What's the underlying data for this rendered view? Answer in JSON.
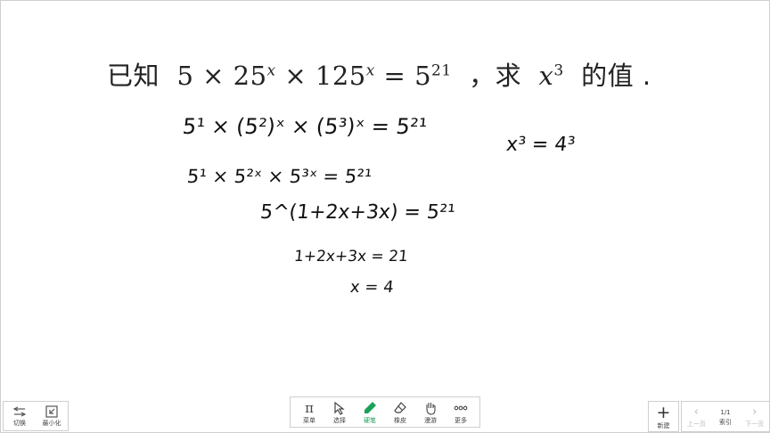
{
  "problem": {
    "prefix": "已知",
    "expr_a": "5 × 25",
    "exp_x1": "x",
    "expr_b": " × 125",
    "exp_x2": "x",
    "expr_c": " = 5",
    "exp_21": "21",
    "sep": "，求",
    "var": "x",
    "exp_3": "3",
    "suffix": "的值 ."
  },
  "handwriting": [
    "5¹ × (5²)ˣ × (5³)ˣ = 5²¹",
    "5¹ × 5²ˣ × 5³ˣ = 5²¹",
    "5^(1+2x+3x) = 5²¹",
    "1+2x+3x = 21",
    "x = 4",
    "x³ = 4³"
  ],
  "bottom_left": {
    "switch_label": "切换",
    "minimize_label": "最小化"
  },
  "toolbar": {
    "menu_label": "菜单",
    "select_label": "选择",
    "pen_label": "硬笔",
    "eraser_label": "橡皮",
    "roam_label": "漫游",
    "more_label": "更多"
  },
  "nav": {
    "new_label": "新建",
    "prev_label": "上一页",
    "page": "1/1",
    "index_label": "索引",
    "next_label": "下一页"
  },
  "colors": {
    "active_tool": "#1aa15a",
    "border": "#cfcfcf"
  }
}
